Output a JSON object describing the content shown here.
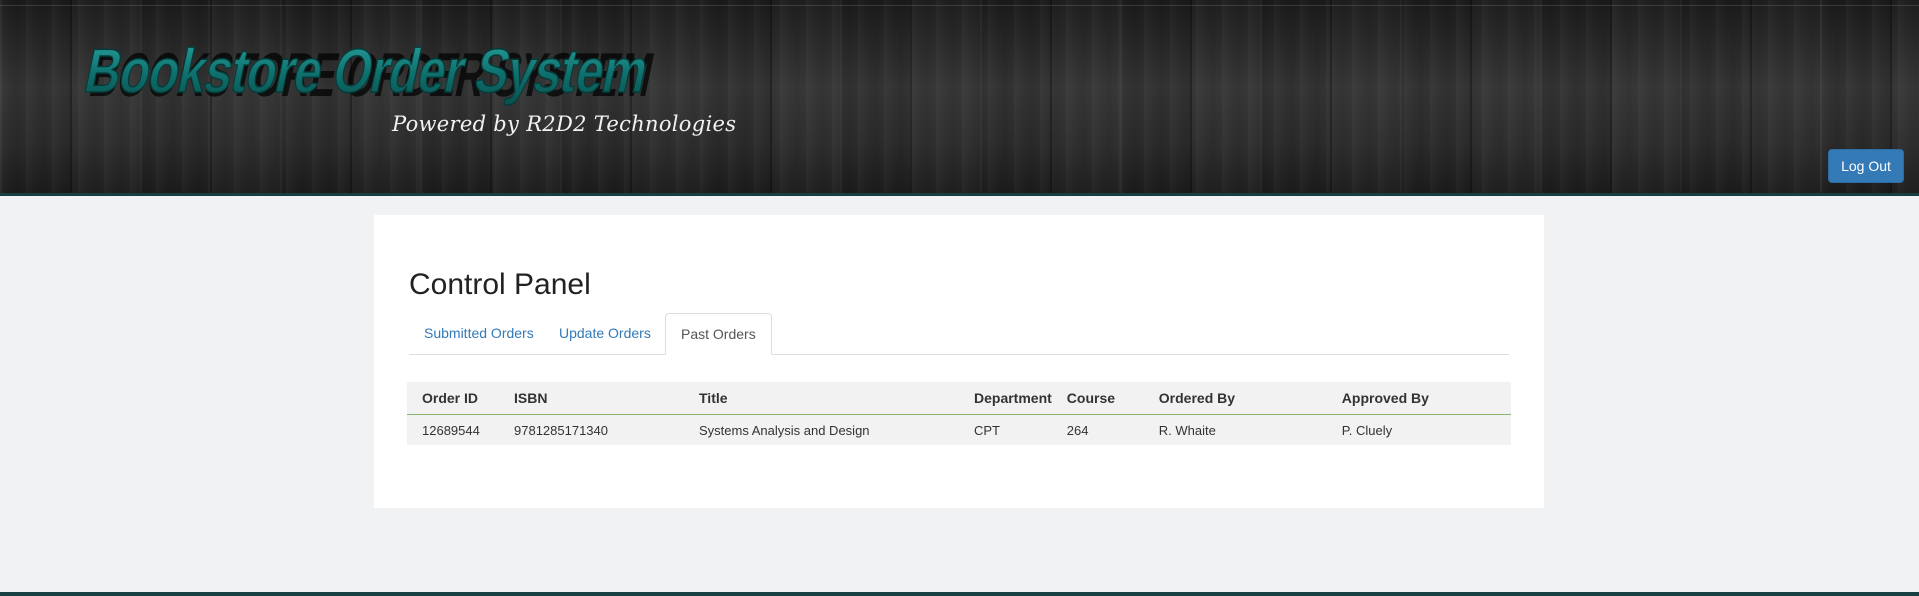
{
  "header": {
    "logo_text": "Bookstore Order System",
    "tagline": "Powered by R2D2 Technologies",
    "logout_label": "Log Out",
    "accent_color": "#0f6b68",
    "logout_color": "#337ab7"
  },
  "main": {
    "title": "Control Panel",
    "tabs": [
      {
        "label": "Submitted Orders",
        "active": false
      },
      {
        "label": "Update Orders",
        "active": false
      },
      {
        "label": "Past Orders",
        "active": true
      }
    ],
    "table": {
      "columns": [
        "Order ID",
        "ISBN",
        "Title",
        "Department",
        "Course",
        "Ordered By",
        "Approved By"
      ],
      "rows": [
        [
          "12689544",
          "9781285171340",
          "Systems Analysis and Design",
          "CPT",
          "264",
          "R. Whaite",
          "P. Cluely"
        ]
      ]
    }
  }
}
